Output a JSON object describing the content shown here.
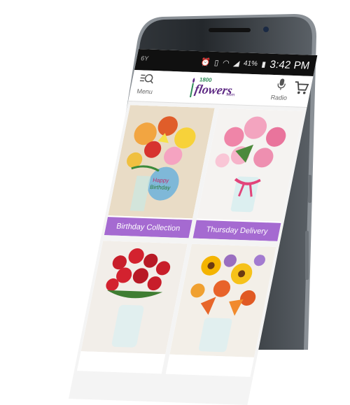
{
  "status_bar": {
    "carrier": "6Y",
    "battery": "41%",
    "time": "3:42 PM",
    "icons": [
      "alarm-icon",
      "vibrate-icon",
      "wifi-icon",
      "signal-icon",
      "battery-icon"
    ]
  },
  "header": {
    "menu_label": "Menu",
    "logo_number": "1800",
    "logo_word": "flowers",
    "logo_suffix": ".com",
    "radio_label": "Radio",
    "cart_icon": "cart-icon"
  },
  "tiles": [
    {
      "label": "Birthday Collection",
      "image": "birthday-bouquet-image"
    },
    {
      "label": "Thursday Delivery",
      "image": "pink-lily-bouquet-image"
    },
    {
      "label": "",
      "image": "red-roses-bouquet-image"
    },
    {
      "label": "",
      "image": "sunflower-bouquet-image"
    }
  ],
  "colors": {
    "accent": "#a56ad1",
    "brand_purple": "#5e2a84",
    "brand_green": "#2e8b57",
    "status_bar": "#101010"
  }
}
